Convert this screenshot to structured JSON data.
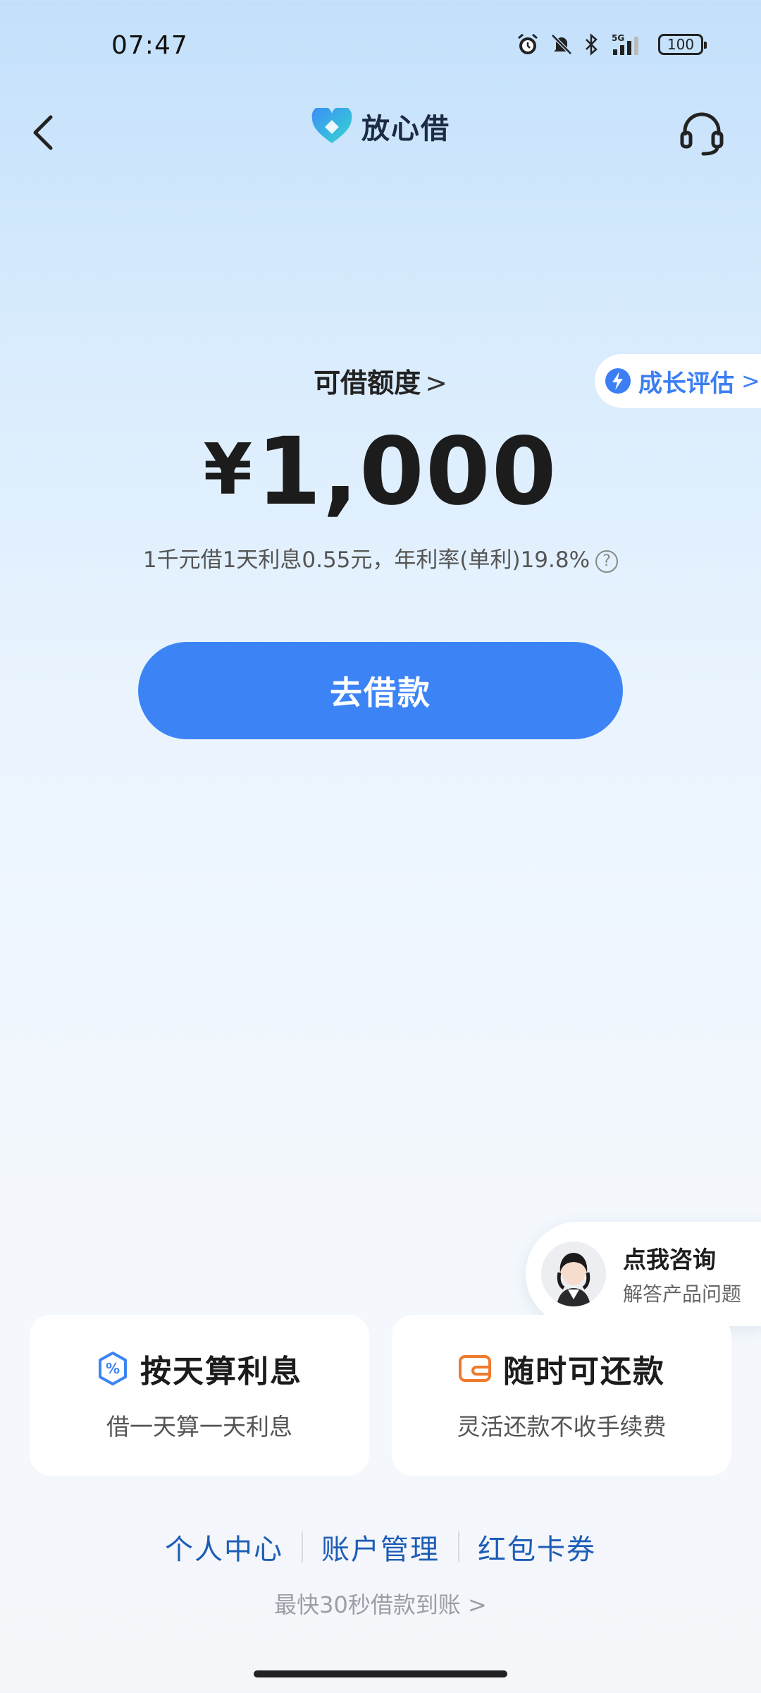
{
  "status_bar": {
    "time": "07:47",
    "battery": "100"
  },
  "header": {
    "brand_name": "放心借"
  },
  "quota": {
    "label": "可借额度",
    "chevron": ">",
    "currency": "¥",
    "amount": "1,000",
    "rate_text": "1千元借1天利息0.55元，年利率(单利)19.8%",
    "help": "?"
  },
  "growth": {
    "label": "成长评估",
    "chevron": ">"
  },
  "borrow_button": {
    "label": "去借款"
  },
  "consult": {
    "title": "点我咨询",
    "subtitle": "解答产品问题"
  },
  "features": [
    {
      "title": "按天算利息",
      "subtitle": "借一天算一天利息",
      "icon": "percent-hexagon-icon"
    },
    {
      "title": "随时可还款",
      "subtitle": "灵活还款不收手续费",
      "icon": "wallet-icon"
    }
  ],
  "links": [
    "个人中心",
    "账户管理",
    "红包卡券"
  ],
  "fast_note": "最快30秒借款到账 >",
  "colors": {
    "accent": "#3c84f6",
    "link": "#1d5db6",
    "orange": "#f07a2c"
  }
}
